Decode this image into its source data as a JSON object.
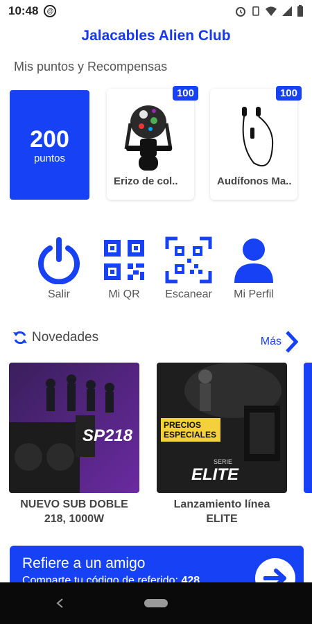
{
  "status_bar": {
    "time": "10:48"
  },
  "app": {
    "title": "Jalacables Alien Club"
  },
  "rewards_section": {
    "label": "Mis puntos y Recompensas"
  },
  "points": {
    "value": "200",
    "label": "puntos"
  },
  "rewards": [
    {
      "name": "Erizo de col..",
      "points": "100"
    },
    {
      "name": "Audífonos Ma..",
      "points": "100"
    }
  ],
  "actions": [
    {
      "label": "Salir",
      "icon": "power-icon"
    },
    {
      "label": "Mi QR",
      "icon": "qr-code-icon"
    },
    {
      "label": "Escanear",
      "icon": "qr-scan-icon"
    },
    {
      "label": "Mi Perfil",
      "icon": "user-icon"
    }
  ],
  "news": {
    "header": "Novedades",
    "more_label": "Más",
    "items": [
      {
        "title": "NUEVO SUB DOBLE 218, 1000W",
        "image_text": "SP218"
      },
      {
        "title": "Lanzamiento línea ELITE",
        "image_text": "ELITE",
        "promo_text": "PRECIOS ESPECIALES",
        "series_text": "SERIE"
      }
    ]
  },
  "referral": {
    "title": "Refiere a un amigo",
    "subtitle": "Comparte tu código de referido:",
    "code": "428"
  },
  "colors": {
    "accent": "#1641f5",
    "title": "#1738f0"
  }
}
